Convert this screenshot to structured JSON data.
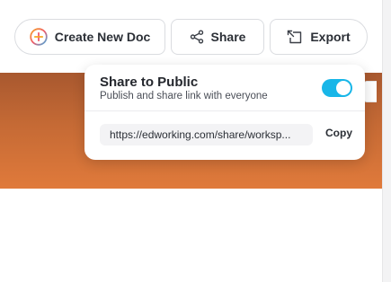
{
  "toolbar": {
    "create_label": "Create New Doc",
    "share_label": "Share",
    "export_label": "Export"
  },
  "share_popover": {
    "title": "Share to Public",
    "subtitle": "Publish and share link with everyone",
    "toggle_on": true,
    "link": "https://edworking.com/share/worksp...",
    "copy_label": "Copy"
  },
  "colors": {
    "accent": "#18b6e8",
    "banner_top": "#a8582f",
    "banner_bottom": "#e07a3b"
  },
  "icons": {
    "create": "plus-circle-icon",
    "share": "share-icon",
    "export": "export-icon"
  }
}
